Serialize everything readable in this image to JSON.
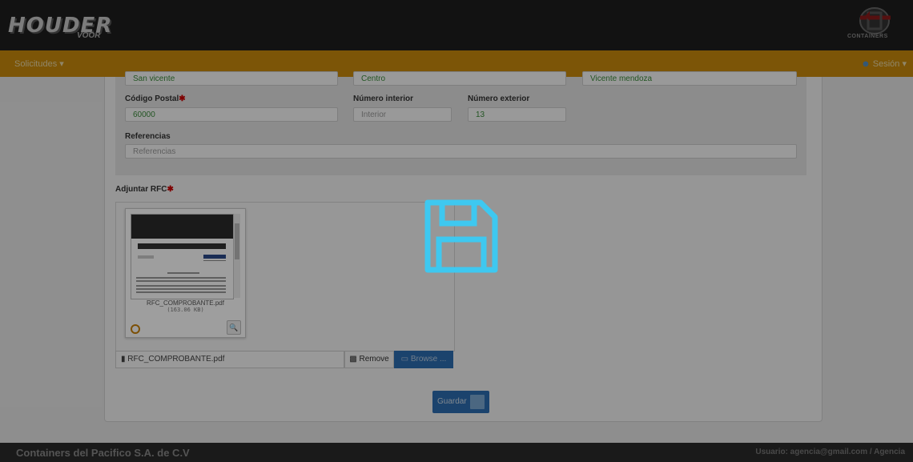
{
  "brand": {
    "left_logo": "HOUDER",
    "left_logo_sub": "VOOR",
    "right_logo_name": "CONTAINERS"
  },
  "navbar": {
    "menu_label": "Solicitudes ▾",
    "session_label": "Sesión ▾"
  },
  "address": {
    "row1": {
      "field1": "San vicente",
      "field2": "Centro",
      "field3": "Vicente mendoza"
    },
    "postal_label": "Código Postal",
    "postal_value": "60000",
    "interior_label": "Número interior",
    "interior_placeholder": "Interior",
    "exterior_label": "Número exterior",
    "exterior_value": "13",
    "references_label": "Referencias",
    "references_placeholder": "Referencias"
  },
  "attachment": {
    "label": "Adjuntar RFC",
    "required_mark": "✱",
    "preview_file_name": "RFC_COMPROBANTE.pdf",
    "preview_file_size": "(163.06 KB)",
    "selected_file": "RFC_COMPROBANTE.pdf",
    "remove_label": "Remove",
    "browse_label": "Browse ..."
  },
  "actions": {
    "save_label": "Guardar"
  },
  "footer": {
    "company": "Containers del Pacifico S.A. de C.V",
    "user": "Usuario: agencia@gmail.com / Agencia"
  },
  "colors": {
    "navbar": "#c88a0c",
    "primary": "#2d6cb0",
    "overlay_icon": "#3ec8f0"
  },
  "icons": [
    "save-icon",
    "file-icon",
    "trash-icon",
    "folder-open-icon",
    "gear-icon",
    "zoom-icon",
    "user-icon"
  ]
}
